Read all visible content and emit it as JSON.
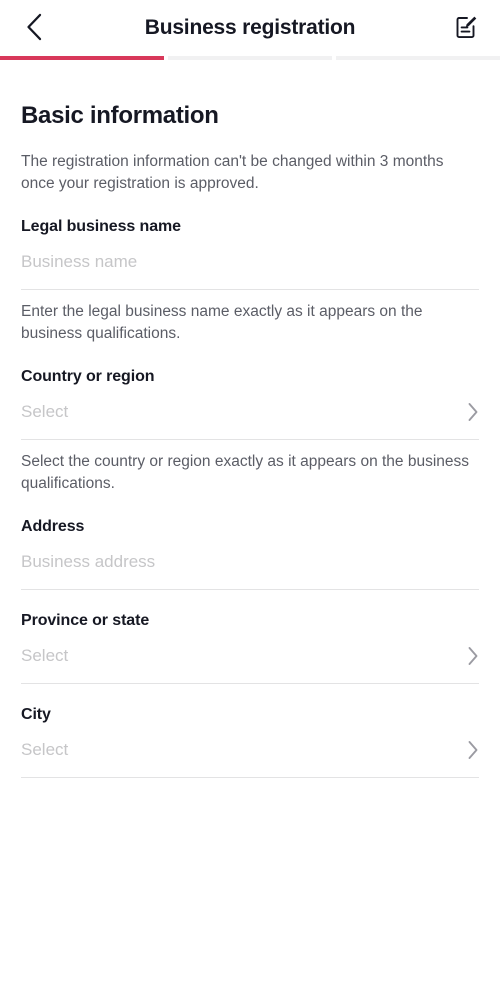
{
  "header": {
    "title": "Business registration",
    "back_icon": "chevron-left-icon",
    "edit_icon": "edit-document-icon"
  },
  "progress": {
    "steps": 3,
    "active_step": 1,
    "active_color": "#d8385a",
    "inactive_color": "#f1f1f2"
  },
  "main": {
    "section_title": "Basic information",
    "section_desc": "The registration information can't be changed within 3 months once your registration is approved.",
    "fields": [
      {
        "label": "Legal business name",
        "placeholder": "Business name",
        "value": "",
        "type": "input",
        "help": "Enter the legal business name exactly as it appears on the business qualifications."
      },
      {
        "label": "Country or region",
        "placeholder": "Select",
        "value": "",
        "type": "select",
        "chevron": "chevron-right-icon",
        "help": "Select the country or region exactly as it appears on the business qualifications."
      },
      {
        "label": "Address",
        "placeholder": "Business address",
        "value": "",
        "type": "input",
        "help": ""
      },
      {
        "label": "Province or state",
        "placeholder": "Select",
        "value": "",
        "type": "select",
        "chevron": "chevron-right-icon",
        "help": ""
      },
      {
        "label": "City",
        "placeholder": "Select",
        "value": "",
        "type": "select",
        "chevron": "chevron-right-icon",
        "help": ""
      }
    ]
  }
}
